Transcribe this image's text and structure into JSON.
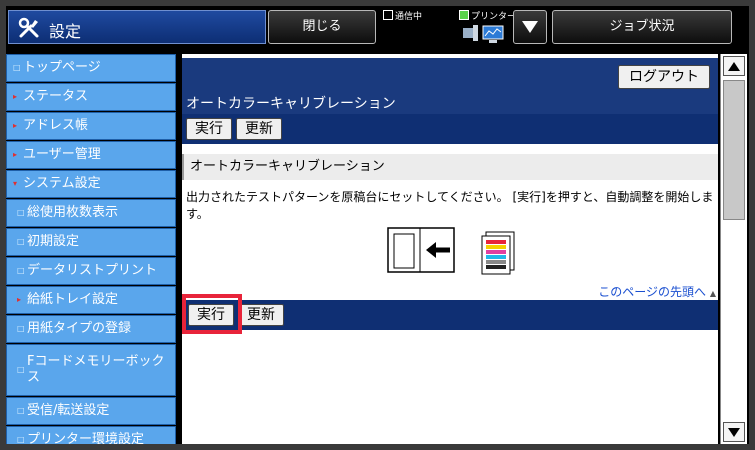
{
  "topbar": {
    "title": "設定",
    "close_label": "閉じる",
    "status_comm": "通信中",
    "status_printer": "プリンター",
    "job_label": "ジョブ状況"
  },
  "sidebar": {
    "items": [
      {
        "label": "トップページ",
        "marker": "□"
      },
      {
        "label": "ステータス",
        "marker": "▸"
      },
      {
        "label": "アドレス帳",
        "marker": "▸"
      },
      {
        "label": "ユーザー管理",
        "marker": "▸"
      },
      {
        "label": "システム設定",
        "marker": "▾"
      },
      {
        "label": "総使用枚数表示",
        "marker": "□"
      },
      {
        "label": "初期設定",
        "marker": "□"
      },
      {
        "label": "データリストプリント",
        "marker": "□"
      },
      {
        "label": "給紙トレイ設定",
        "marker": "▸"
      },
      {
        "label": "用紙タイプの登録",
        "marker": "□"
      },
      {
        "label": "Fコードメモリーボックス",
        "marker": "□"
      },
      {
        "label": "受信/転送設定",
        "marker": "□"
      },
      {
        "label": "プリンター環境設定",
        "marker": "□"
      }
    ]
  },
  "main": {
    "logout_label": "ログアウト",
    "page_title": "オートカラーキャリブレーション",
    "execute_label": "実行",
    "update_label": "更新",
    "section_title": "オートカラーキャリブレーション",
    "description": "出力されたテストパターンを原稿台にセットしてください。 [実行]を押すと、自動調整を開始します。",
    "top_link": "このページの先頭へ"
  },
  "colors": {
    "header_blue": "#1a3a7e",
    "sidebar_blue": "#5aa6ec",
    "highlight_red": "#e8243a",
    "link_blue": "#1a4fd0"
  }
}
